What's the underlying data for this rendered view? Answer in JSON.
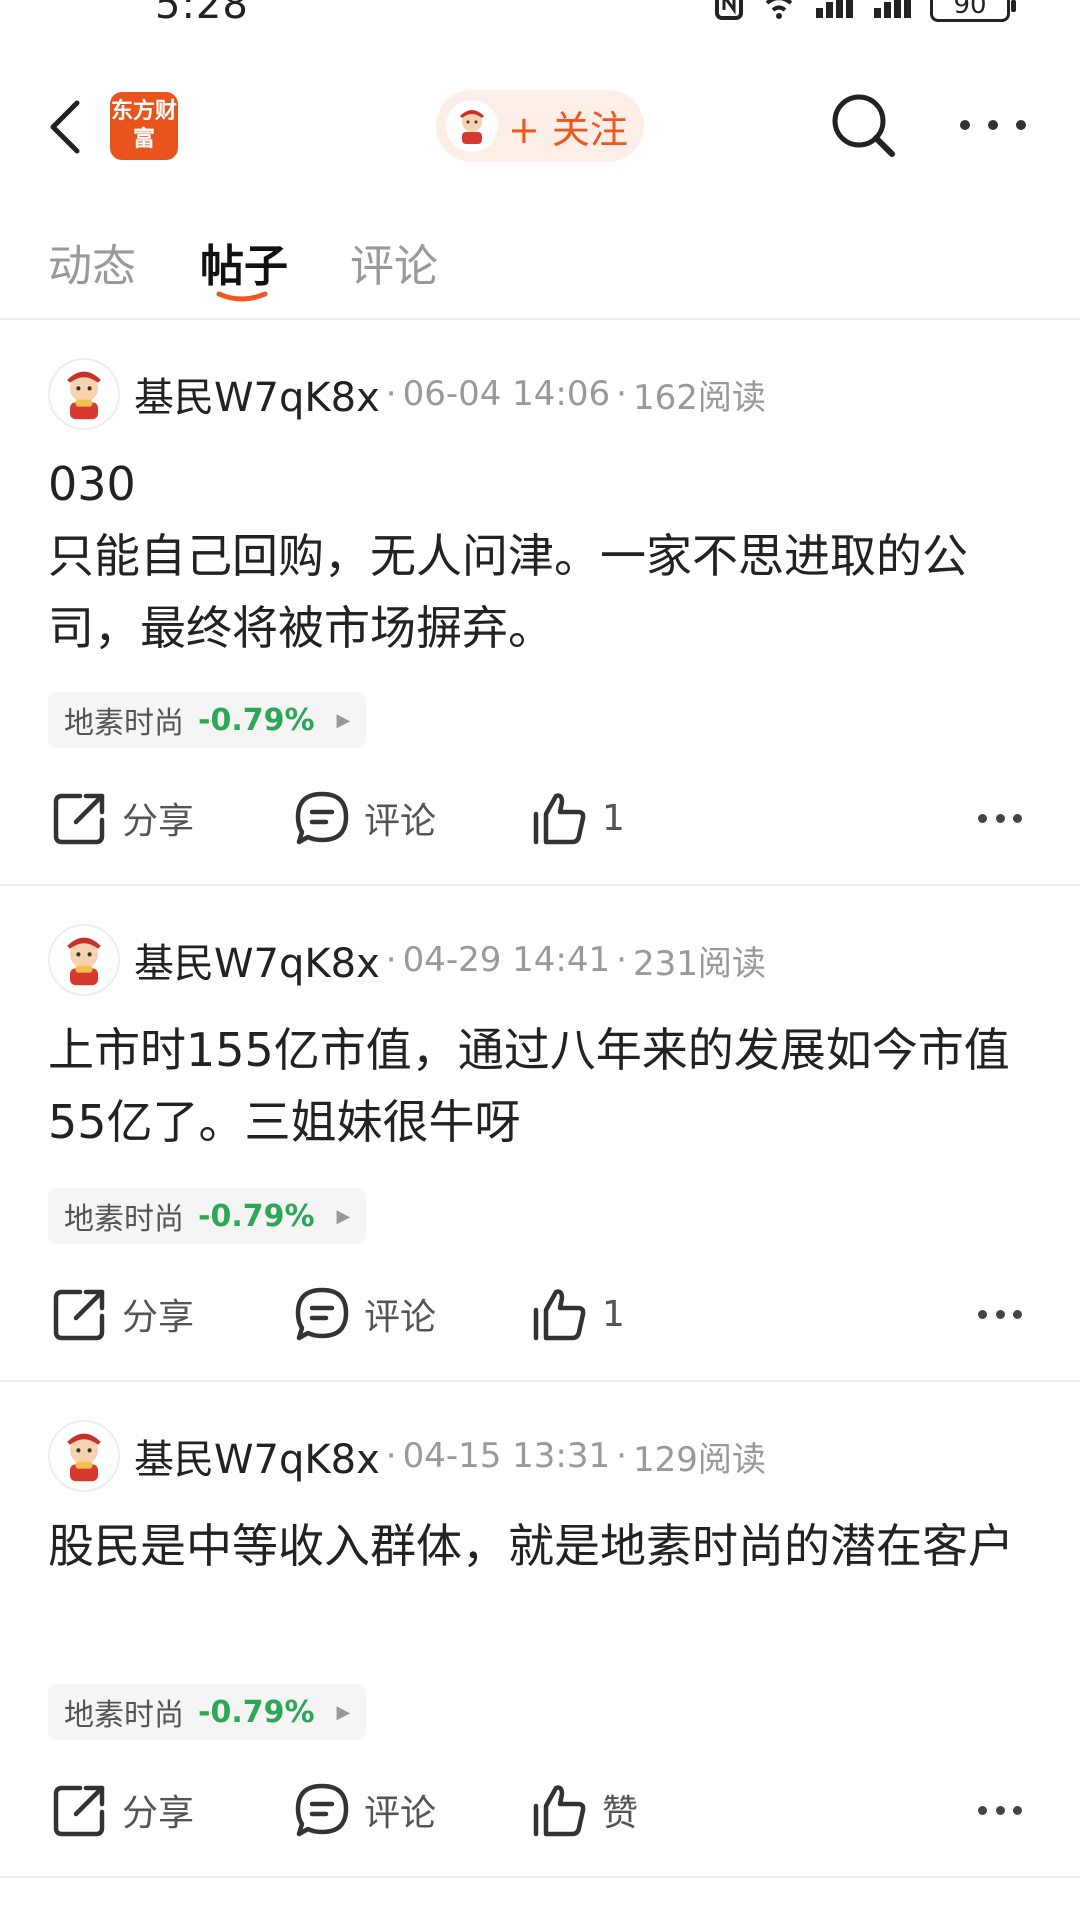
{
  "status_bar": {
    "time": "5:28",
    "battery": "90"
  },
  "header": {
    "logo_text": "东方财富",
    "follow_label": "+ 关注"
  },
  "tabs": [
    {
      "label": "动态",
      "active": false
    },
    {
      "label": "帖子",
      "active": true
    },
    {
      "label": "评论",
      "active": false
    }
  ],
  "posts": [
    {
      "username": "基民W7qK8x",
      "time": "06-04 14:06",
      "reads": "162阅读",
      "body": "030\n只能自己回购，无人问津。一家不思进取的公司，最终将被市场摒弃。",
      "stock_name": "地素时尚",
      "stock_change": "-0.79%",
      "share_label": "分享",
      "comment_label": "评论",
      "like_label": "1"
    },
    {
      "username": "基民W7qK8x",
      "time": "04-29 14:41",
      "reads": "231阅读",
      "body": "上市时155亿市值，通过八年来的发展如今市值55亿了。三姐妹很牛呀",
      "stock_name": "地素时尚",
      "stock_change": "-0.79%",
      "share_label": "分享",
      "comment_label": "评论",
      "like_label": "1"
    },
    {
      "username": "基民W7qK8x",
      "time": "04-15 13:31",
      "reads": "129阅读",
      "body": "股民是中等收入群体，就是地素时尚的潜在客户",
      "stock_name": "地素时尚",
      "stock_change": "-0.79%",
      "share_label": "分享",
      "comment_label": "评论",
      "like_label": "赞"
    }
  ],
  "colors": {
    "brand_orange": "#f0561d",
    "stock_down": "#2aa855"
  },
  "icons": [
    "back-icon",
    "search-icon",
    "more-icon",
    "share-icon",
    "comment-icon",
    "like-icon"
  ]
}
